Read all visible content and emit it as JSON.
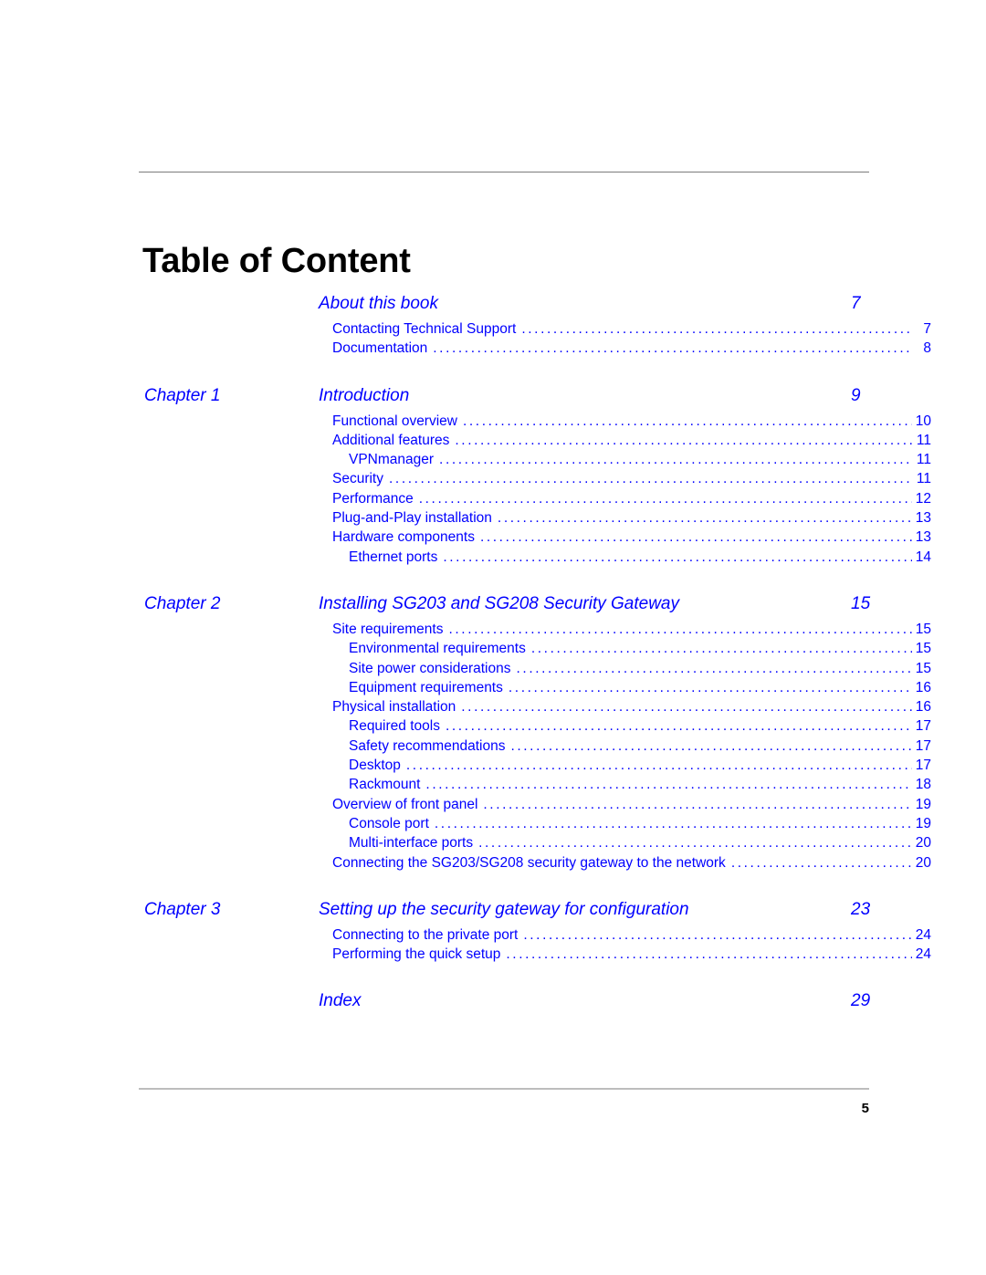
{
  "document": {
    "title": "Table of Content",
    "footer_page_number": "5"
  },
  "toc": {
    "sections": [
      {
        "chapter_label": "",
        "title": "About this book",
        "page": "7",
        "entries": [
          {
            "level": 1,
            "text": "Contacting Technical Support",
            "page": "7"
          },
          {
            "level": 1,
            "text": "Documentation",
            "page": "8"
          }
        ]
      },
      {
        "chapter_label": "Chapter 1",
        "title": "Introduction",
        "page": "9",
        "entries": [
          {
            "level": 1,
            "text": "Functional overview",
            "page": "10"
          },
          {
            "level": 1,
            "text": "Additional features",
            "page": "11"
          },
          {
            "level": 2,
            "text": "VPNmanager",
            "page": "11"
          },
          {
            "level": 1,
            "text": "Security",
            "page": "11"
          },
          {
            "level": 1,
            "text": "Performance",
            "page": "12"
          },
          {
            "level": 1,
            "text": "Plug-and-Play installation",
            "page": "13"
          },
          {
            "level": 1,
            "text": "Hardware components",
            "page": "13"
          },
          {
            "level": 2,
            "text": "Ethernet ports",
            "page": "14"
          }
        ]
      },
      {
        "chapter_label": "Chapter 2",
        "title": "Installing SG203 and SG208 Security Gateway",
        "page": "15",
        "entries": [
          {
            "level": 1,
            "text": "Site requirements",
            "page": "15"
          },
          {
            "level": 2,
            "text": "Environmental requirements",
            "page": "15"
          },
          {
            "level": 2,
            "text": "Site power considerations",
            "page": "15"
          },
          {
            "level": 2,
            "text": "Equipment requirements",
            "page": "16"
          },
          {
            "level": 1,
            "text": "Physical installation",
            "page": "16"
          },
          {
            "level": 2,
            "text": "Required tools",
            "page": "17"
          },
          {
            "level": 2,
            "text": "Safety recommendations",
            "page": "17"
          },
          {
            "level": 2,
            "text": "Desktop",
            "page": "17"
          },
          {
            "level": 2,
            "text": "Rackmount",
            "page": "18"
          },
          {
            "level": 1,
            "text": "Overview of front panel",
            "page": "19"
          },
          {
            "level": 2,
            "text": "Console port",
            "page": "19"
          },
          {
            "level": 2,
            "text": "Multi-interface ports",
            "page": "20"
          },
          {
            "level": 1,
            "text": "Connecting the SG203/SG208 security gateway to the network",
            "page": "20"
          }
        ]
      },
      {
        "chapter_label": "Chapter 3",
        "title": "Setting up the security gateway for configuration",
        "page": "23",
        "entries": [
          {
            "level": 1,
            "text": "Connecting to the private port",
            "page": "24"
          },
          {
            "level": 1,
            "text": "Performing the quick setup",
            "page": "24"
          }
        ]
      },
      {
        "chapter_label": "",
        "title": "Index",
        "page": "29",
        "entries": []
      }
    ]
  },
  "colors": {
    "link_blue": "#0000ff",
    "title_black": "#000000",
    "rule_top_gray": "#7b7b7b",
    "rule_bottom_gray": "#bdbdbd"
  }
}
